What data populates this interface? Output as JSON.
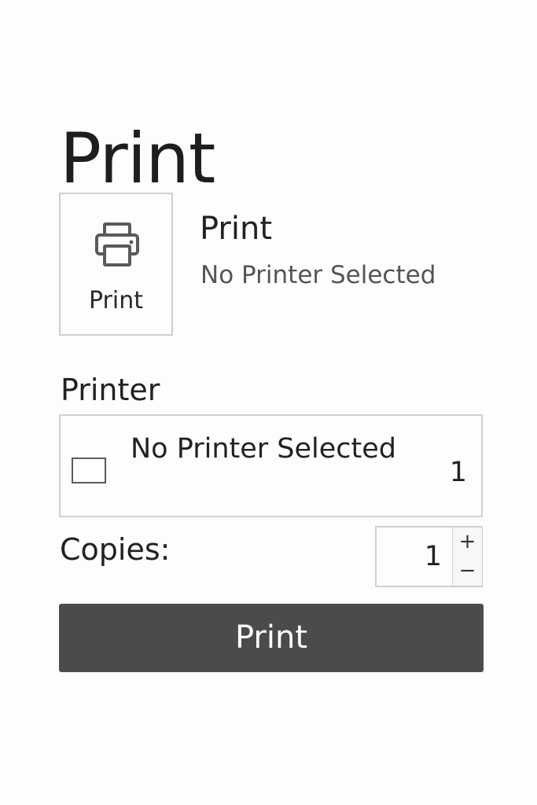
{
  "page": {
    "title": "Print"
  },
  "print_tile": {
    "icon": "printer-icon",
    "label": "Print"
  },
  "print_info": {
    "title": "Print",
    "status": "No Printer Selected"
  },
  "printer": {
    "label": "Printer",
    "selected": "No Printer Selected",
    "count": "1",
    "icon": "printer-box-icon"
  },
  "copies": {
    "label": "Copies:",
    "value": "1",
    "increment": "+",
    "decrement": "−"
  },
  "actions": {
    "print_label": "Print"
  },
  "colors": {
    "background": "#fdfdfd",
    "border": "#cfcfcf",
    "button_bg": "#4b4b4b",
    "button_text": "#ffffff",
    "text": "#222222",
    "muted_text": "#555555"
  }
}
